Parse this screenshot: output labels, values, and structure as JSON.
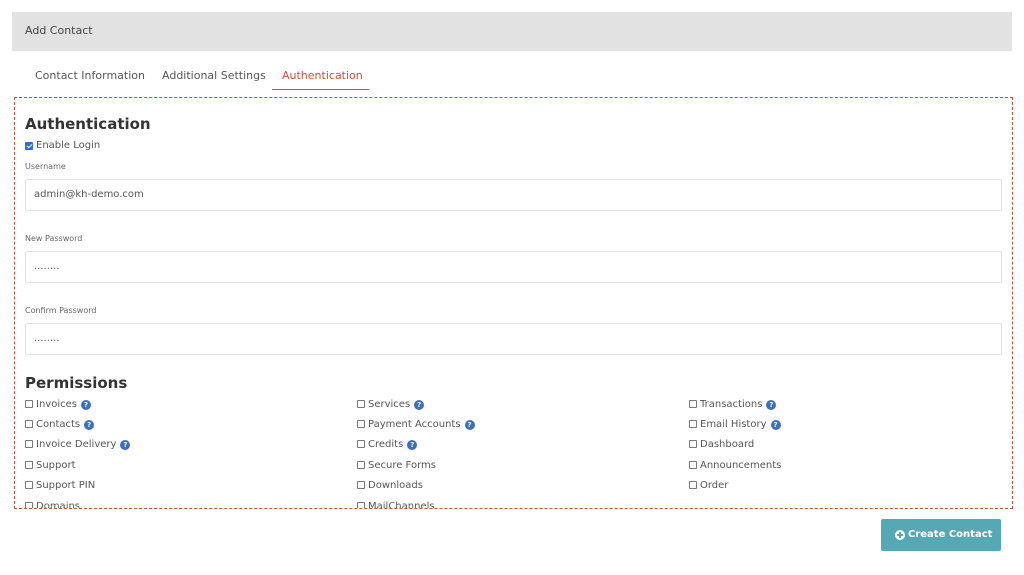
{
  "header": {
    "title": "Add Contact"
  },
  "tabs": [
    {
      "label": "Contact Information"
    },
    {
      "label": "Additional Settings"
    },
    {
      "label": "Authentication"
    }
  ],
  "auth": {
    "title": "Authentication",
    "enable_login_label": "Enable Login",
    "enable_login_checked": true,
    "username_label": "Username",
    "username_value": "admin@kh-demo.com",
    "new_password_label": "New Password",
    "new_password_value": "........",
    "confirm_password_label": "Confirm Password",
    "confirm_password_value": "........"
  },
  "permissions": {
    "title": "Permissions",
    "col1": [
      {
        "label": "Invoices",
        "help": true
      },
      {
        "label": "Contacts",
        "help": true
      },
      {
        "label": "Invoice Delivery",
        "help": true
      },
      {
        "label": "Support",
        "help": false
      },
      {
        "label": "Support PIN",
        "help": false
      },
      {
        "label": "Domains",
        "help": false
      }
    ],
    "col2": [
      {
        "label": "Services",
        "help": true
      },
      {
        "label": "Payment Accounts",
        "help": true
      },
      {
        "label": "Credits",
        "help": true
      },
      {
        "label": "Secure Forms",
        "help": false
      },
      {
        "label": "Downloads",
        "help": false
      },
      {
        "label": "MailChannels",
        "help": false
      }
    ],
    "col3": [
      {
        "label": "Transactions",
        "help": true
      },
      {
        "label": "Email History",
        "help": true
      },
      {
        "label": "Dashboard",
        "help": false
      },
      {
        "label": "Announcements",
        "help": false
      },
      {
        "label": "Order",
        "help": false
      }
    ]
  },
  "actions": {
    "create_label": "Create Contact"
  },
  "icons": {
    "help": "question-circle-icon",
    "create": "plus-circle-icon"
  },
  "colors": {
    "accent": "#d24b3e",
    "button": "#55a9b4",
    "help": "#3c6fc2"
  }
}
